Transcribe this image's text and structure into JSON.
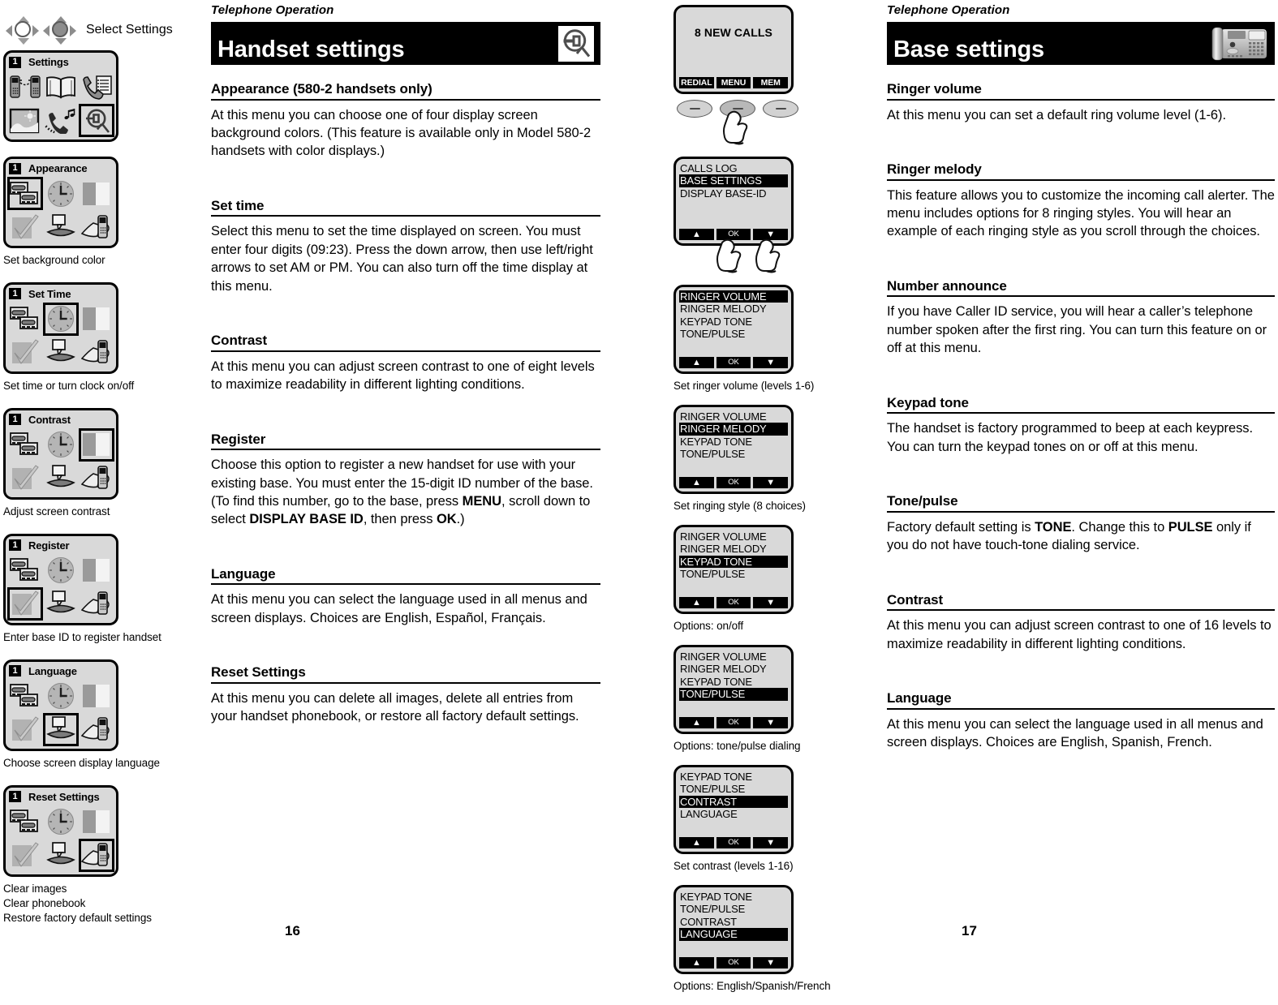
{
  "document": {
    "running_head_left": "Telephone Operation",
    "running_head_right": "Telephone Operation",
    "page_left": "16",
    "page_right": "17"
  },
  "left_figures": {
    "nav_label": "Select Settings",
    "nav_icons": [
      "nav-pad-outline-icon",
      "nav-pad-filled-icon"
    ],
    "menu_cards": [
      {
        "number": "1",
        "title": "Settings",
        "selected_index": 5,
        "icons": [
          "two-handsets-icon",
          "open-book-icon",
          "handset-list-icon",
          "picture-frame-icon",
          "ringer-music-icon",
          "settings-magnifier-icon"
        ],
        "caption": ""
      },
      {
        "number": "1",
        "title": "Appearance",
        "selected_index": 0,
        "icons": [
          "screens-icon",
          "clock-icon",
          "contrast-bar-icon",
          "checkmark-icon",
          "speech-mouth-icon",
          "handset-hand-icon"
        ],
        "caption": "Set background color"
      },
      {
        "number": "1",
        "title": "Set Time",
        "selected_index": 1,
        "icons": [
          "screens-icon",
          "clock-icon",
          "contrast-bar-icon",
          "checkmark-icon",
          "speech-mouth-icon",
          "handset-hand-icon"
        ],
        "caption": "Set time or turn clock on/off"
      },
      {
        "number": "1",
        "title": "Contrast",
        "selected_index": 2,
        "icons": [
          "screens-icon",
          "clock-icon",
          "contrast-bar-icon",
          "checkmark-icon",
          "speech-mouth-icon",
          "handset-hand-icon"
        ],
        "caption": "Adjust screen contrast"
      },
      {
        "number": "1",
        "title": "Register",
        "selected_index": 3,
        "icons": [
          "screens-icon",
          "clock-icon",
          "contrast-bar-icon",
          "checkmark-icon",
          "speech-mouth-icon",
          "handset-hand-icon"
        ],
        "caption": "Enter base ID to register handset"
      },
      {
        "number": "1",
        "title": "Language",
        "selected_index": 4,
        "icons": [
          "screens-icon",
          "clock-icon",
          "contrast-bar-icon",
          "checkmark-icon",
          "speech-mouth-icon",
          "handset-hand-icon"
        ],
        "caption": "Choose screen display language"
      },
      {
        "number": "1",
        "title": "Reset Settings",
        "selected_index": 5,
        "icons": [
          "screens-icon",
          "clock-icon",
          "contrast-bar-icon",
          "checkmark-icon",
          "speech-mouth-icon",
          "handset-hand-icon"
        ],
        "caption": "Clear images\nClear phonebook\nRestore factory default settings"
      }
    ]
  },
  "left_column": {
    "banner_title": "Handset settings",
    "banner_icon": "settings-magnifier-icon",
    "sections": [
      {
        "heading": "Appearance (580-2 handsets only)",
        "body": "At this menu you can choose one of four display screen background colors. (This feature is available only in Model 580-2 handsets with color displays.)"
      },
      {
        "heading": "Set time",
        "body": "Select this menu to set the time displayed on screen. You must enter four digits (09:23). Press the down arrow, then use left/right arrows to set AM or PM. You can also turn off the time display at this menu."
      },
      {
        "heading": "Contrast",
        "body": "At this menu you can adjust screen contrast to one of eight levels to maximize readability in different lighting conditions."
      },
      {
        "heading": "Register",
        "body_html": "Choose this option to register a new handset for use with your existing base. You must enter the 15-digit ID number of the base. (To find this number, go to the base, press <b>MENU</b>, scroll down to select <b>DISPLAY BASE ID</b>, then press <b>OK</b>.)"
      },
      {
        "heading": "Language",
        "body": "At this menu you can select the language used in all menus and screen displays. Choices are English, Español, Français."
      },
      {
        "heading": "Reset Settings",
        "body": "At this menu you can delete all images, delete all entries from your handset phonebook, or restore all factory default settings."
      }
    ]
  },
  "right_figures": {
    "screens": [
      {
        "type": "idle",
        "big_text": "8 NEW CALLS",
        "softkeys": [
          "REDIAL",
          "MENU",
          "MEM"
        ],
        "caption": ""
      },
      {
        "type": "menu",
        "lines": [
          "CALLS LOG",
          "BASE SETTINGS",
          "DISPLAY BASE-ID"
        ],
        "highlight_index": 1,
        "softkeys": [
          "▲",
          "OK",
          "▼"
        ],
        "caption": ""
      },
      {
        "type": "menu",
        "lines": [
          "RINGER VOLUME",
          "RINGER MELODY",
          "KEYPAD TONE",
          "TONE/PULSE"
        ],
        "highlight_index": 0,
        "softkeys": [
          "▲",
          "OK",
          "▼"
        ],
        "caption": "Set ringer volume (levels 1-6)"
      },
      {
        "type": "menu",
        "lines": [
          "RINGER VOLUME",
          "RINGER MELODY",
          "KEYPAD TONE",
          "TONE/PULSE"
        ],
        "highlight_index": 1,
        "softkeys": [
          "▲",
          "OK",
          "▼"
        ],
        "caption": "Set ringing style (8 choices)"
      },
      {
        "type": "menu",
        "lines": [
          "RINGER VOLUME",
          "RINGER MELODY",
          "KEYPAD TONE",
          "TONE/PULSE"
        ],
        "highlight_index": 2,
        "softkeys": [
          "▲",
          "OK",
          "▼"
        ],
        "caption": "Options: on/off"
      },
      {
        "type": "menu",
        "lines": [
          "RINGER VOLUME",
          "RINGER MELODY",
          "KEYPAD TONE",
          "TONE/PULSE"
        ],
        "highlight_index": 3,
        "softkeys": [
          "▲",
          "OK",
          "▼"
        ],
        "caption": "Options: tone/pulse dialing"
      },
      {
        "type": "menu",
        "lines": [
          "KEYPAD TONE",
          "TONE/PULSE",
          "CONTRAST",
          "LANGUAGE"
        ],
        "highlight_index": 2,
        "softkeys": [
          "▲",
          "OK",
          "▼"
        ],
        "caption": "Set contrast (levels 1-16)"
      },
      {
        "type": "menu",
        "lines": [
          "KEYPAD TONE",
          "TONE/PULSE",
          "CONTRAST",
          "LANGUAGE"
        ],
        "highlight_index": 3,
        "softkeys": [
          "▲",
          "OK",
          "▼"
        ],
        "caption": "Options: English/Spanish/French"
      }
    ]
  },
  "right_column": {
    "banner_title": "Base settings",
    "banner_icon": "base-telephone-photo",
    "sections": [
      {
        "heading": "Ringer volume",
        "body": "At this menu you can set a default ring volume level (1-6)."
      },
      {
        "heading": "Ringer melody",
        "body": "This feature allows you to customize the incoming call alerter. The menu includes options for 8 ringing styles. You will hear an example of each ringing style as you scroll through the choices."
      },
      {
        "heading": "Number announce",
        "body": "If you have Caller ID service, you will hear a caller’s telephone number spoken after the first ring. You can turn this feature on or off at this menu."
      },
      {
        "heading": "Keypad tone",
        "body": "The handset is factory programmed to beep at each keypress. You can turn the keypad tones on or off at this menu."
      },
      {
        "heading": "Tone/pulse",
        "body_html": "Factory default setting is <b>TONE</b>. Change this to <b>PULSE</b> only if you do not have touch-tone dialing service."
      },
      {
        "heading": "Contrast",
        "body": "At this menu you can adjust screen contrast to one of 16 levels to maximize readability in different lighting conditions."
      },
      {
        "heading": "Language",
        "body": "At this menu you can select the language used in all menus and screen displays. Choices are English, Spanish, French."
      }
    ]
  }
}
